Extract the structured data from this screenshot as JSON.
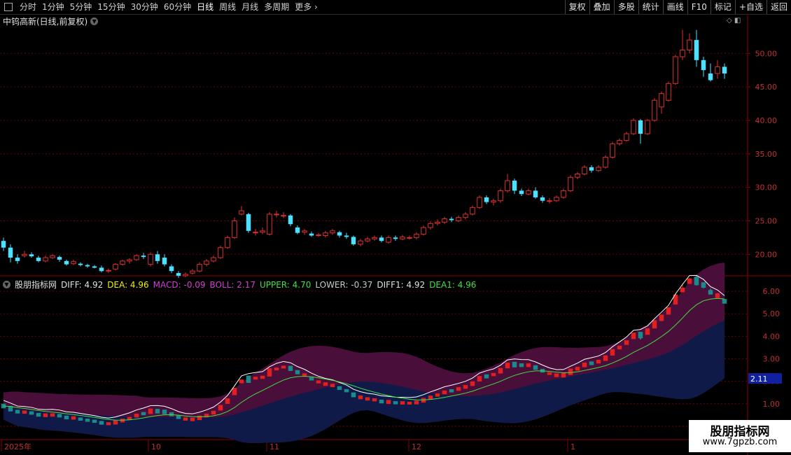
{
  "toolbar": {
    "periods": [
      "分时",
      "1分钟",
      "5分钟",
      "15分钟",
      "30分钟",
      "60分钟",
      "日线",
      "周线",
      "月线",
      "多周期",
      "更多"
    ],
    "active_index": 6,
    "buttons": [
      "复权",
      "叠加",
      "多股",
      "统计",
      "画线",
      "F10",
      "标记",
      "+自选",
      "返回"
    ]
  },
  "main_chart": {
    "title": "中钨高新(日线,前复权)",
    "y_ticks": [
      "50.00",
      "45.00",
      "40.00",
      "35.00",
      "30.00",
      "25.00",
      "20.00"
    ]
  },
  "indicator": {
    "name": "股朋指标网",
    "values": [
      {
        "label": "DIFF: 4.92",
        "color": "#e0e0e0"
      },
      {
        "label": "DEA: 4.96",
        "color": "#f0f000"
      },
      {
        "label": "MACD: -0.09",
        "color": "#d040d0"
      },
      {
        "label": "BOLL: 2.17",
        "color": "#d040d0"
      },
      {
        "label": "UPPER: 4.70",
        "color": "#40e040"
      },
      {
        "label": "LOWER: -0.37",
        "color": "#c8c8c8"
      },
      {
        "label": "DIFF1: 4.92",
        "color": "#e0e0e0"
      },
      {
        "label": "DEA1: 4.96",
        "color": "#40e040"
      }
    ],
    "y_ticks": [
      "6.00",
      "5.00",
      "4.00",
      "3.00",
      "2.00",
      "1.00",
      "0.00"
    ],
    "current_value": "2.11"
  },
  "x_axis": {
    "labels": [
      "2025年",
      "10",
      "11",
      "12",
      "1"
    ]
  },
  "watermark": {
    "line1": "股朋指标网",
    "line2": "www.7gpzb.com"
  },
  "chart_data": {
    "type": "candlestick",
    "title": "中钨高新(日线,前复权)",
    "price_axis": [
      17,
      54
    ],
    "indicator_axis": [
      -0.5,
      6.5
    ],
    "candles": [
      [
        22,
        21,
        22.5,
        20.5
      ],
      [
        21,
        19.5,
        21.5,
        18.8
      ],
      [
        19.5,
        19,
        20,
        18.6
      ],
      [
        19.8,
        20,
        20.5,
        19.5
      ],
      [
        20,
        19.7,
        20.3,
        19.5
      ],
      [
        19.5,
        19,
        19.8,
        18.8
      ],
      [
        19,
        19.5,
        19.8,
        18.8
      ],
      [
        19.5,
        19.8,
        20,
        19.3
      ],
      [
        19.6,
        19.2,
        19.8,
        18.9
      ],
      [
        19,
        18.5,
        19.2,
        18.3
      ],
      [
        18.6,
        18.9,
        19.2,
        18.4
      ],
      [
        18.6,
        18.4,
        18.8,
        18.2
      ],
      [
        18.4,
        18.2,
        18.6,
        18
      ],
      [
        18.2,
        18,
        18.4,
        17.9
      ],
      [
        18,
        17.5,
        18.3,
        17.3
      ],
      [
        17.5,
        17.6,
        17.9,
        17.2
      ],
      [
        17.8,
        18.5,
        18.7,
        17.6
      ],
      [
        18.5,
        19,
        19.2,
        18.3
      ],
      [
        19,
        19.2,
        19.4,
        18.6
      ],
      [
        19.2,
        19.8,
        20,
        19
      ],
      [
        19.8,
        19.6,
        20.2,
        19.3
      ],
      [
        18.5,
        20,
        20.3,
        18.2
      ],
      [
        20,
        19,
        20.5,
        18.6
      ],
      [
        19.5,
        18.5,
        20,
        18.2
      ],
      [
        18.2,
        17.5,
        18.5,
        17.2
      ],
      [
        17.2,
        16.8,
        17.5,
        16.5
      ],
      [
        16.8,
        17,
        17.3,
        16.6
      ],
      [
        17.2,
        17.5,
        17.8,
        17
      ],
      [
        17.5,
        18.5,
        18.8,
        17.3
      ],
      [
        18.5,
        19,
        19.3,
        18.2
      ],
      [
        19,
        19.5,
        19.8,
        18.8
      ],
      [
        19.5,
        21,
        21.3,
        19.3
      ],
      [
        21,
        22.5,
        22.8,
        20.8
      ],
      [
        22.5,
        25,
        25.5,
        22.3
      ],
      [
        26,
        26.5,
        27.2,
        25.8
      ],
      [
        26,
        23.5,
        26.2,
        23.2
      ],
      [
        23.3,
        23.3,
        23.8,
        22.8
      ],
      [
        23.3,
        23.5,
        24,
        23
      ],
      [
        23,
        26,
        26.3,
        22.8
      ],
      [
        26,
        26,
        26.5,
        25.5
      ],
      [
        25.8,
        25.8,
        26.3,
        25.4
      ],
      [
        25.8,
        24.5,
        26,
        24.2
      ],
      [
        24,
        23.2,
        24.3,
        23
      ],
      [
        23.3,
        23.5,
        23.8,
        22.9
      ],
      [
        23.1,
        22.8,
        23.4,
        22.6
      ],
      [
        22.8,
        22.9,
        23.2,
        22.6
      ],
      [
        22.8,
        23.2,
        23.5,
        22.5
      ],
      [
        23.2,
        23.5,
        23.8,
        22.9
      ],
      [
        23.3,
        22.8,
        23.5,
        22.5
      ],
      [
        22.8,
        22.6,
        23.2,
        22.3
      ],
      [
        22.6,
        21.5,
        22.8,
        21.3
      ],
      [
        21.5,
        22,
        22.3,
        21.2
      ],
      [
        22,
        22.3,
        22.6,
        21.8
      ],
      [
        22.3,
        22.5,
        22.8,
        22
      ],
      [
        22.5,
        22,
        22.8,
        21.8
      ],
      [
        21.8,
        22.5,
        22.8,
        21.6
      ],
      [
        22.5,
        22.3,
        22.8,
        22
      ],
      [
        22.3,
        22.6,
        22.9,
        22.1
      ],
      [
        22.5,
        22.5,
        22.8,
        22.2
      ],
      [
        22.5,
        23,
        23.3,
        22.2
      ],
      [
        23,
        24,
        24.3,
        22.8
      ],
      [
        24,
        24.6,
        24.9,
        23.7
      ],
      [
        24.6,
        24.8,
        25.2,
        24.3
      ],
      [
        24.8,
        25.3,
        25.6,
        24.5
      ],
      [
        25.3,
        25.1,
        25.6,
        24.8
      ],
      [
        25,
        25.5,
        25.8,
        24.8
      ],
      [
        25.5,
        26,
        26.3,
        25.2
      ],
      [
        26,
        27,
        27.3,
        25.8
      ],
      [
        27,
        28.5,
        28.8,
        26.8
      ],
      [
        28.5,
        27.8,
        28.8,
        27.5
      ],
      [
        27.8,
        28,
        28.3,
        27.3
      ],
      [
        28,
        29.5,
        29.8,
        27.7
      ],
      [
        29.5,
        31,
        32,
        29.2
      ],
      [
        31,
        29.5,
        31.3,
        29
      ],
      [
        29.5,
        29,
        29.8,
        28.7
      ],
      [
        29,
        29.5,
        29.8,
        28.8
      ],
      [
        29.5,
        28.5,
        30,
        28.3
      ],
      [
        28.5,
        28,
        28.8,
        27.7
      ],
      [
        28,
        28,
        28.4,
        27.6
      ],
      [
        28,
        28.5,
        28.8,
        27.8
      ],
      [
        28.5,
        29.5,
        29.8,
        28.3
      ],
      [
        29.5,
        31.5,
        31.8,
        29.3
      ],
      [
        31.5,
        32,
        32.3,
        31.2
      ],
      [
        32,
        33,
        33.3,
        31.8
      ],
      [
        33,
        32.5,
        33.3,
        32.2
      ],
      [
        32.5,
        33,
        33.3,
        32.3
      ],
      [
        33,
        34.5,
        34.8,
        32.8
      ],
      [
        34.5,
        36.5,
        36.8,
        34.3
      ],
      [
        36.5,
        37,
        37.3,
        36.2
      ],
      [
        37,
        38,
        38.3,
        36.8
      ],
      [
        38,
        40,
        40.3,
        37.8
      ],
      [
        40,
        38,
        40.2,
        36.5
      ],
      [
        38,
        40,
        40.2,
        37.8
      ],
      [
        40,
        43,
        43.3,
        39.8
      ],
      [
        42,
        44,
        44.3,
        41
      ],
      [
        43,
        45.5,
        45.8,
        42.8
      ],
      [
        45.5,
        49.5,
        49.8,
        45.3
      ],
      [
        49.5,
        50.5,
        53.5,
        49
      ],
      [
        50.5,
        52,
        53,
        50
      ],
      [
        52,
        49,
        53.5,
        48
      ],
      [
        49,
        47.5,
        49.5,
        46.5
      ],
      [
        47,
        46,
        48.5,
        45.8
      ],
      [
        47,
        48,
        49,
        46.2
      ],
      [
        48,
        47,
        48.5,
        46.2
      ]
    ],
    "indicator_series": [
      {
        "name": "DIFF",
        "color": "#ffffff"
      },
      {
        "name": "DEA",
        "color": "#40e040"
      },
      {
        "name": "UPPER",
        "color": "#5a1040"
      },
      {
        "name": "LOWER",
        "color": "#1a2a5a"
      }
    ]
  }
}
